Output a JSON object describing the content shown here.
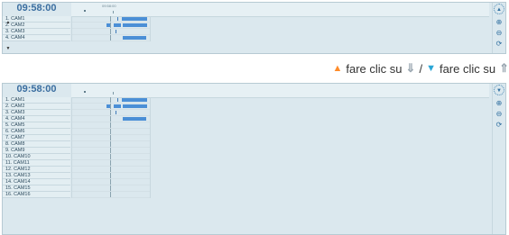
{
  "top_panel": {
    "time": "09:58:00",
    "ruler_label": "09:58:00",
    "cams": [
      "1. CAM1",
      "2. CAM2",
      "3. CAM3",
      "4. CAM4"
    ]
  },
  "caption": {
    "part1": "fare clic su",
    "part2": "/",
    "part3": "fare clic su",
    "up_symbol": "▲",
    "down_symbol": "▼",
    "arrow_down": "⇓",
    "arrow_up": "⇑"
  },
  "bottom_panel": {
    "time": "09:58:00",
    "cams": [
      "1. CAM1",
      "2. CAM2",
      "3. CAM3",
      "4. CAM4",
      "5. CAM5",
      "6. CAM6",
      "7. CAM7",
      "8. CAM8",
      "9. CAM9",
      "10. CAM10",
      "11. CAM11",
      "12. CAM12",
      "13. CAM13",
      "14. CAM14",
      "15. CAM15",
      "16. CAM16"
    ]
  },
  "icons": {
    "zoom_in": "⊕",
    "zoom_out": "⊖",
    "refresh": "⟳",
    "scroll_up": "▲",
    "scroll_down": "▼"
  }
}
